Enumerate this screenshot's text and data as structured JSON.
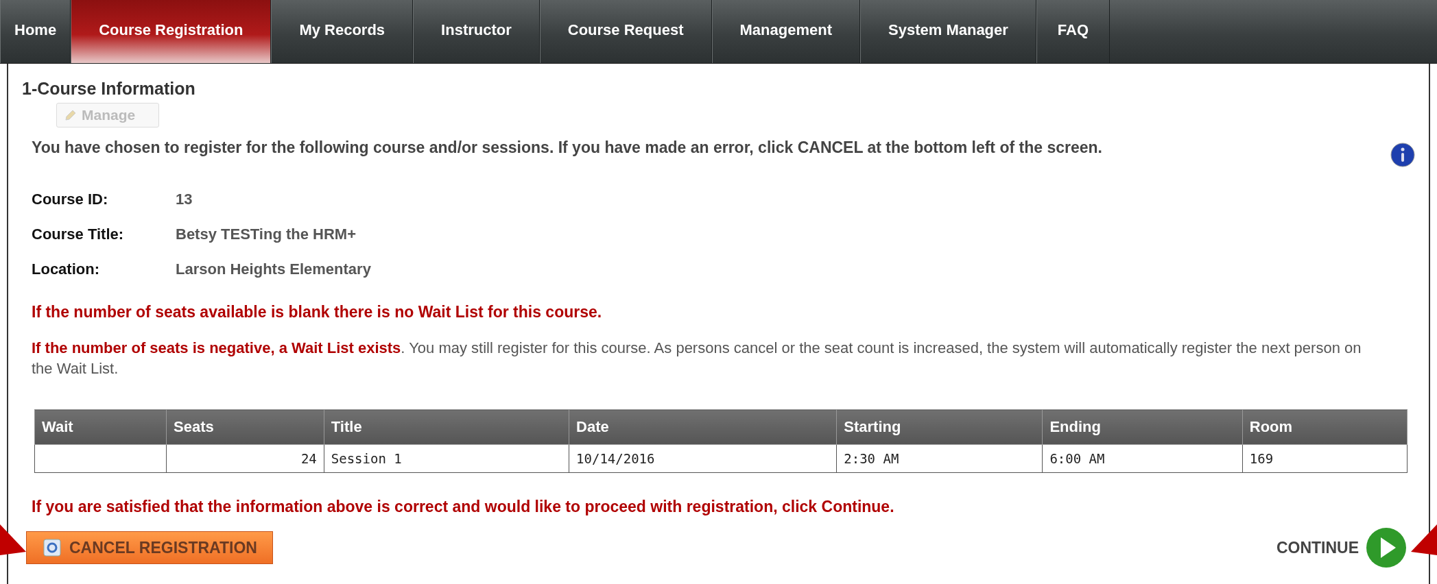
{
  "nav": {
    "tabs": [
      {
        "label": "Home",
        "selected": false
      },
      {
        "label": "Course Registration",
        "selected": true
      },
      {
        "label": "My Records",
        "selected": false
      },
      {
        "label": "Instructor",
        "selected": false
      },
      {
        "label": "Course Request",
        "selected": false
      },
      {
        "label": "Management",
        "selected": false
      },
      {
        "label": "System Manager",
        "selected": false
      },
      {
        "label": "FAQ",
        "selected": false
      }
    ]
  },
  "section_title": "1-Course Information",
  "manage_button": {
    "label": "Manage",
    "disabled": true
  },
  "intro": "You have chosen to register for the following course and/or sessions. If you have made an error, click CANCEL at the bottom left of the screen.",
  "fields": [
    {
      "label": "Course ID:",
      "value": "13"
    },
    {
      "label": "Course Title:",
      "value": "Betsy TESTing the HRM+"
    },
    {
      "label": "Location:",
      "value": "Larson Heights Elementary"
    }
  ],
  "notice_blank": "If the number of seats available is blank there is no Wait List for this course.",
  "notice_negative": "**If the number of seats is negative, a Wait List exists**. You may still register for this course. As persons cancel or the seat count is increased, the system will automatically register the next person on the Wait List.",
  "table": {
    "columns": [
      "Wait",
      "Seats",
      "Title",
      "Date",
      "Starting",
      "Ending",
      "Room"
    ],
    "rows": [
      [
        "",
        "24",
        "Session 1",
        "10/14/2016",
        "2:30 AM",
        "6:00 AM",
        "169"
      ]
    ]
  },
  "confirm_notice": "If you are satisfied that the information above is correct and would like to proceed with registration, click Continue.",
  "cancel_button": "CANCEL REGISTRATION",
  "continue_button": "CONTINUE"
}
